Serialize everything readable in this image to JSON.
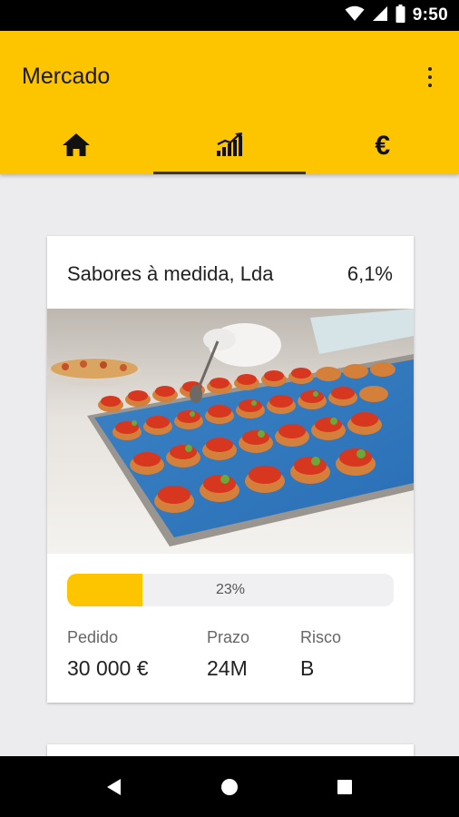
{
  "status_bar": {
    "time": "9:50",
    "icons": [
      "wifi-icon",
      "cell-signal-icon",
      "battery-icon"
    ]
  },
  "app_bar": {
    "title": "Mercado",
    "overflow_icon": "more-vert-icon",
    "background_color": "#fdc500"
  },
  "tabs": [
    {
      "icon": "home-icon",
      "active": false
    },
    {
      "icon": "chart-bars-icon",
      "active": true
    },
    {
      "icon": "euro-icon",
      "glyph": "€",
      "active": false
    }
  ],
  "cards": [
    {
      "company": "Sabores à medida, Lda",
      "rate": "6,1%",
      "image": "food-platter-photo",
      "progress": {
        "percent": 23,
        "label": "23%"
      },
      "stats": [
        {
          "label": "Pedido",
          "value": "30 000 €"
        },
        {
          "label": "Prazo",
          "value": "24M"
        },
        {
          "label": "Risco",
          "value": "B"
        }
      ]
    }
  ],
  "navigation_bar": {
    "buttons": [
      "back-icon",
      "home-circle-icon",
      "recents-square-icon"
    ]
  }
}
